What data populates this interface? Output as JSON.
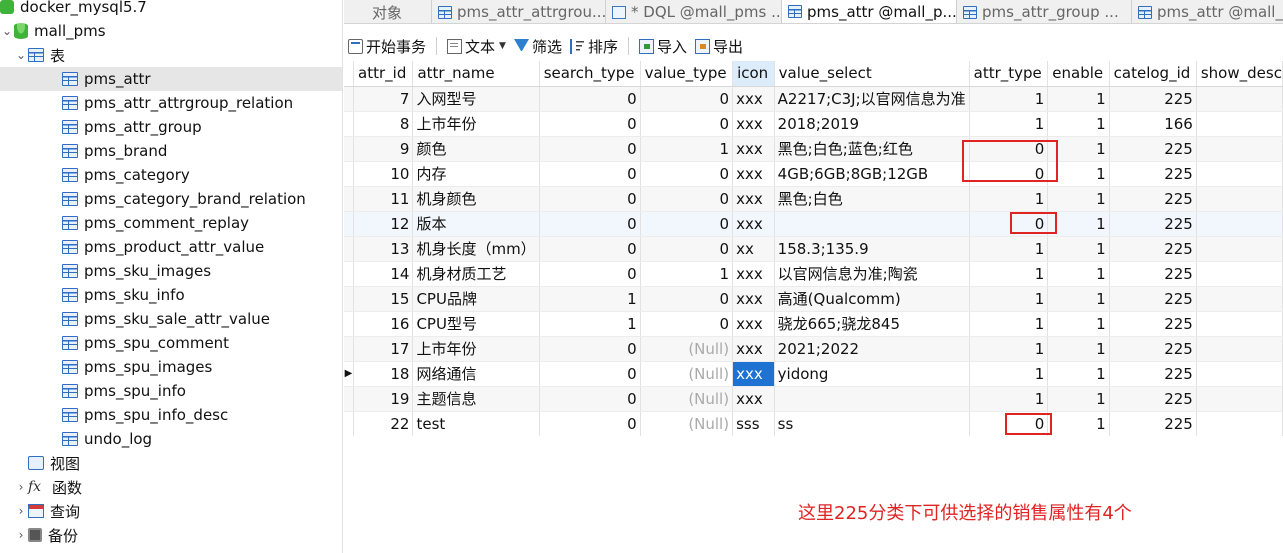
{
  "tree": {
    "items": [
      {
        "label": "docker_mysql5.7",
        "icon": "connection-icon"
      },
      {
        "label": "mall_pms",
        "icon": "database-icon"
      },
      {
        "label": "表",
        "icon": "tables-icon"
      },
      {
        "label": "pms_attr",
        "icon": "table-icon"
      },
      {
        "label": "pms_attr_attrgroup_relation",
        "icon": "table-icon"
      },
      {
        "label": "pms_attr_group",
        "icon": "table-icon"
      },
      {
        "label": "pms_brand",
        "icon": "table-icon"
      },
      {
        "label": "pms_category",
        "icon": "table-icon"
      },
      {
        "label": "pms_category_brand_relation",
        "icon": "table-icon"
      },
      {
        "label": "pms_comment_replay",
        "icon": "table-icon"
      },
      {
        "label": "pms_product_attr_value",
        "icon": "table-icon"
      },
      {
        "label": "pms_sku_images",
        "icon": "table-icon"
      },
      {
        "label": "pms_sku_info",
        "icon": "table-icon"
      },
      {
        "label": "pms_sku_sale_attr_value",
        "icon": "table-icon"
      },
      {
        "label": "pms_spu_comment",
        "icon": "table-icon"
      },
      {
        "label": "pms_spu_images",
        "icon": "table-icon"
      },
      {
        "label": "pms_spu_info",
        "icon": "table-icon"
      },
      {
        "label": "pms_spu_info_desc",
        "icon": "table-icon"
      },
      {
        "label": "undo_log",
        "icon": "table-icon"
      },
      {
        "label": "视图",
        "icon": "view-icon"
      },
      {
        "label": "函数",
        "icon": "function-icon"
      },
      {
        "label": "查询",
        "icon": "query-icon"
      },
      {
        "label": "备份",
        "icon": "backup-icon"
      }
    ]
  },
  "tabs": [
    {
      "label": "对象"
    },
    {
      "label": "pms_attr_attrgrou..."
    },
    {
      "label": "* DQL @mall_pms ..."
    },
    {
      "label": "pms_attr @mall_p..."
    },
    {
      "label": "pms_attr_group ..."
    },
    {
      "label": "pms_attr @mall_p"
    }
  ],
  "toolbar": {
    "begin_tx": "开始事务",
    "text": "文本",
    "filter": "筛选",
    "sort": "排序",
    "import": "导入",
    "export": "导出"
  },
  "grid": {
    "columns": [
      "attr_id",
      "attr_name",
      "search_type",
      "value_type",
      "icon",
      "value_select",
      "attr_type",
      "enable",
      "catelog_id",
      "show_desc"
    ],
    "null_text": "(Null)",
    "rows": [
      {
        "attr_id": "7",
        "attr_name": "入网型号",
        "search_type": "0",
        "value_type": "0",
        "icon": "xxx",
        "value_select": "A2217;C3J;以官网信息为准",
        "attr_type": "1",
        "enable": "1",
        "catelog_id": "225"
      },
      {
        "attr_id": "8",
        "attr_name": "上市年份",
        "search_type": "0",
        "value_type": "0",
        "icon": "xxx",
        "value_select": "2018;2019",
        "attr_type": "1",
        "enable": "1",
        "catelog_id": "166"
      },
      {
        "attr_id": "9",
        "attr_name": "颜色",
        "search_type": "0",
        "value_type": "1",
        "icon": "xxx",
        "value_select": "黑色;白色;蓝色;红色",
        "attr_type": "0",
        "enable": "1",
        "catelog_id": "225"
      },
      {
        "attr_id": "10",
        "attr_name": "内存",
        "search_type": "0",
        "value_type": "0",
        "icon": "xxx",
        "value_select": "4GB;6GB;8GB;12GB",
        "attr_type": "0",
        "enable": "1",
        "catelog_id": "225"
      },
      {
        "attr_id": "11",
        "attr_name": "机身颜色",
        "search_type": "0",
        "value_type": "0",
        "icon": "xxx",
        "value_select": "黑色;白色",
        "attr_type": "1",
        "enable": "1",
        "catelog_id": "225"
      },
      {
        "attr_id": "12",
        "attr_name": "版本",
        "search_type": "0",
        "value_type": "0",
        "icon": "xxx",
        "value_select": "",
        "attr_type": "0",
        "enable": "1",
        "catelog_id": "225"
      },
      {
        "attr_id": "13",
        "attr_name": "机身长度（mm）",
        "search_type": "0",
        "value_type": "0",
        "icon": "xx",
        "value_select": "158.3;135.9",
        "attr_type": "1",
        "enable": "1",
        "catelog_id": "225"
      },
      {
        "attr_id": "14",
        "attr_name": "机身材质工艺",
        "search_type": "0",
        "value_type": "1",
        "icon": "xxx",
        "value_select": "以官网信息为准;陶瓷",
        "attr_type": "1",
        "enable": "1",
        "catelog_id": "225"
      },
      {
        "attr_id": "15",
        "attr_name": "CPU品牌",
        "search_type": "1",
        "value_type": "0",
        "icon": "xxx",
        "value_select": "高通(Qualcomm)",
        "attr_type": "1",
        "enable": "1",
        "catelog_id": "225"
      },
      {
        "attr_id": "16",
        "attr_name": "CPU型号",
        "search_type": "1",
        "value_type": "0",
        "icon": "xxx",
        "value_select": "骁龙665;骁龙845",
        "attr_type": "1",
        "enable": "1",
        "catelog_id": "225"
      },
      {
        "attr_id": "17",
        "attr_name": "上市年份",
        "search_type": "0",
        "value_type": null,
        "icon": "xxx",
        "value_select": "2021;2022",
        "attr_type": "1",
        "enable": "1",
        "catelog_id": "225"
      },
      {
        "attr_id": "18",
        "attr_name": "网络通信",
        "search_type": "0",
        "value_type": null,
        "icon": "xxx",
        "value_select": "yidong",
        "attr_type": "1",
        "enable": "1",
        "catelog_id": "225"
      },
      {
        "attr_id": "19",
        "attr_name": "主题信息",
        "search_type": "0",
        "value_type": null,
        "icon": "xxx",
        "value_select": "",
        "attr_type": "1",
        "enable": "1",
        "catelog_id": "225"
      },
      {
        "attr_id": "22",
        "attr_name": "test",
        "search_type": "0",
        "value_type": null,
        "icon": "sss",
        "value_select": "ss",
        "attr_type": "0",
        "enable": "1",
        "catelog_id": "225"
      }
    ]
  },
  "annotation": {
    "note": "这里225分类下可供选择的销售属性有4个",
    "color": "#e02424"
  },
  "colors": {
    "selection": "#1e73d2",
    "column_highlight": "#dcecfb",
    "row_selected": "#e6e6e6"
  }
}
